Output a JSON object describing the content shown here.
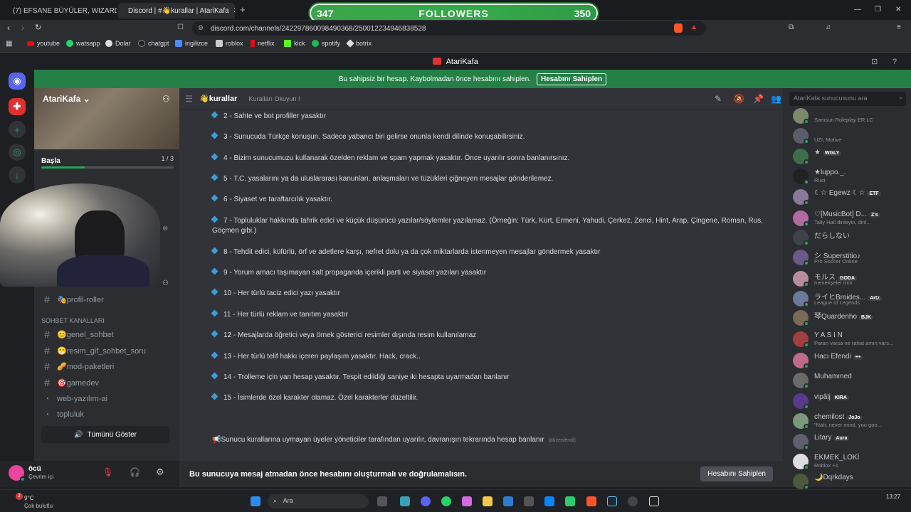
{
  "browser": {
    "tabs": [
      {
        "label": "(7) EFSANE BÜYÜLER, WIZARDRY ve"
      },
      {
        "label": "Discord | #👋kurallar | AtariKafa"
      }
    ],
    "new_tab": "+",
    "url": "discord.com/channels/242297860098490368/250012234946838528",
    "bookmarks": [
      "youtube",
      "watsapp",
      "Dolar",
      "chatgpt",
      "ingilizce",
      "roblox",
      "netflix",
      "kick",
      "spotify",
      "botrix"
    ]
  },
  "overlay": {
    "followers_current": "347",
    "followers_label": "FOLLOWERS",
    "followers_goal": "350"
  },
  "discord": {
    "top_title": "AtariKafa",
    "banner": {
      "text": "Bu sahipsiz bir hesap. Kaybolmadan önce hesabını sahiplen.",
      "button": "Hesabını Sahiplen"
    },
    "guild_name": "AtariKafa",
    "onboarding": {
      "label": "Başla",
      "progress": "1 / 3",
      "fraction": 0.33
    },
    "channels": {
      "roles": "🎭profil-roller",
      "category": "SOHBET KANALLARI",
      "items": [
        "😊genel_sohbet",
        "😁resim_gif_sohbet_soru",
        "🥜mod-paketleri",
        "🎯gamedev",
        "web-yazılım-ai",
        "topluluk"
      ],
      "show_all": "Tümünü Göster"
    },
    "user": {
      "name": "öcü",
      "status": "Çevrim içi"
    },
    "chat_header": {
      "channel": "👋kurallar",
      "topic": "Kuralları Okuyun !"
    },
    "rules": [
      "2 - Sahte ve bot profiller yasaktır",
      "3 - Sunucuda Türkçe konuşun. Sadece yabancı biri gelirse onunla kendi dilinde konuşabilirsiniz.",
      "4 - Bizim sunucumuzu kullanarak özelden reklam ve spam yapmak yasaktır. Önce uyarılır sonra banlanırsınız.",
      "5 - T.C. yasalarını ya da uluslararası kanunları, anlaşmaları ve tüzükleri çiğneyen mesajlar gönderilemez.",
      "6 - Siyaset ve taraftarcılık yasaktır.",
      "7 - Topluluklar hakkında tahrik edici ve küçük düşürücü yazılar/söylemler yazılamaz. (Örneğin: Türk, Kürt, Ermeni, Yahudi, Çerkez, Zenci, Hint, Arap, Çingene, Roman, Rus, Göçmen gibi.)",
      "8 - Tehdit edici, küfürlü, örf ve adetlere karşı, nefret dolu ya da çok miktarlarda istenmeyen mesajlar göndermek yasaktır",
      "9 - Yorum amacı taşımayan salt propaganda içerikli parti ve siyaset yazıları yasaktır",
      "10 - Her türlü taciz edici yazı yasaktır",
      "11 - Her türlü reklam ve tanıtım yasaktır",
      "12 - Mesajlarda öğretici veya örnek gösterici resimler dışında resim kullanılamaz",
      "13 - Her türlü telif hakkı içeren paylaşım yasaktır. Hack, crack..",
      "14 - Trolleme için yan hesap yasaktır. Tespit edildiği saniye iki hesapta uyarmadan banlanır",
      "15 - İsimlerde özel karakter olamaz. Özel karakterler düzeltilir."
    ],
    "footer_note": "📢Sunucu kurallarına uymayan üyeler yöneticiler tarafından uyarılır, davranışın tekrarında hesap banlanır",
    "edited": "(düzenlendi)",
    "composer": {
      "text": "Bu sunucuya mesaj atmadan önce hesabını oluşturmalı ve doğrulamalısın.",
      "button": "Hesabını Sahiplen"
    },
    "search_placeholder": "AtariKafa sunucusunu ara",
    "members": [
      {
        "name": "",
        "status": "Samsun Roleplay ER:LC",
        "tag": ""
      },
      {
        "name": "",
        "status": "UZI, Motive",
        "tag": ""
      },
      {
        "name": "★",
        "status": "",
        "tag": "WGLY"
      },
      {
        "name": "★luppo._.",
        "status": "Rust",
        "tag": ""
      },
      {
        "name": "☾☆ Egewz ☾☆",
        "status": "",
        "tag": "ETF"
      },
      {
        "name": "♡[MusicBot] D...",
        "status": "Tally Hall dinleyin, dinl...",
        "tag": "Z's"
      },
      {
        "name": "だらしない",
        "status": "",
        "tag": ""
      },
      {
        "name": "シ Superstitio♪",
        "status": "Pro Soccer Online",
        "tag": ""
      },
      {
        "name": "モルス",
        "status": "menekşeler mor",
        "tag": "GODA"
      },
      {
        "name": "ライヒBroides...",
        "status": "League of Legends",
        "tag": "Artz"
      },
      {
        "name": "琴Quardenho",
        "status": "",
        "tag": "BJK"
      },
      {
        "name": "Y A S I N",
        "status": "Paran varsa ne rahat amın vars...",
        "tag": ""
      },
      {
        "name": "Hacı Efendi",
        "status": "",
        "tag": "•••"
      },
      {
        "name": "Muhammed",
        "status": "",
        "tag": ""
      },
      {
        "name": "vipâlj",
        "status": "",
        "tag": "KIRA"
      },
      {
        "name": "chemilost",
        "status": "\"Nah, never mind, you goo...",
        "tag": "JoJo"
      },
      {
        "name": "Litary",
        "status": "",
        "tag": "Aura"
      },
      {
        "name": "EKMEK_LOKİ",
        "status": "Roblox +1",
        "tag": ""
      },
      {
        "name": "🌙Dqrkdays",
        "status": "",
        "tag": ""
      }
    ]
  },
  "taskbar": {
    "weather_temp": "9°C",
    "weather_desc": "Çok bulutlu",
    "search": "Ara",
    "time": "13:27",
    "badge": "2"
  },
  "colors": {
    "accent": "#5865f2",
    "banner": "#248046",
    "followers_bar": "#3aa64a",
    "rule_diamond": "#3e9bd8"
  }
}
